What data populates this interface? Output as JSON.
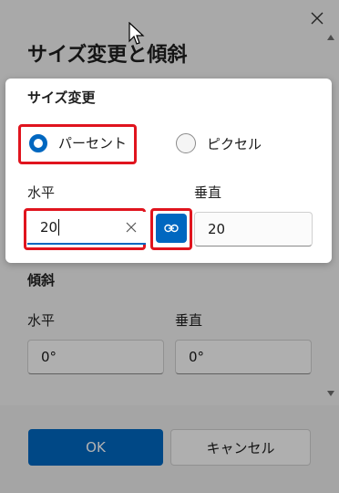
{
  "dialog": {
    "title": "サイズ変更と傾斜",
    "skew": {
      "title": "傾斜",
      "horizontal_label": "水平",
      "horizontal_value": "0°",
      "vertical_label": "垂直",
      "vertical_value": "0°"
    },
    "footer": {
      "ok_label": "OK",
      "cancel_label": "キャンセル"
    }
  },
  "resize_panel": {
    "title": "サイズ変更",
    "options": [
      {
        "label": "パーセント",
        "selected": true
      },
      {
        "label": "ピクセル",
        "selected": false
      }
    ],
    "horizontal_label": "水平",
    "horizontal_value": "20",
    "vertical_label": "垂直",
    "vertical_value": "20",
    "link_aspect": true
  },
  "colors": {
    "accent": "#0067c0",
    "highlight": "#e0141e"
  }
}
